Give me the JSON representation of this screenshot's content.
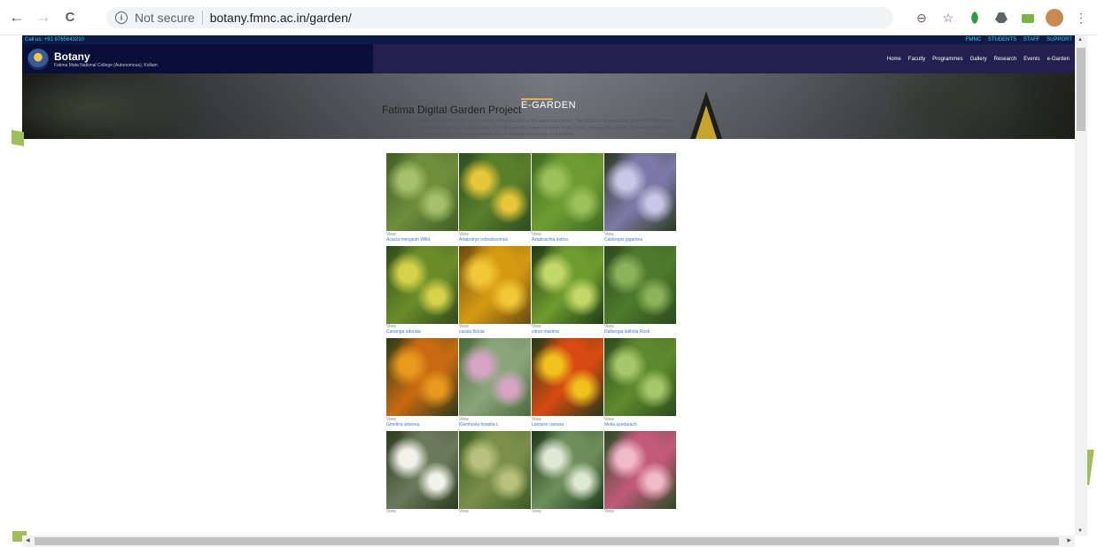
{
  "browser": {
    "back": "←",
    "forward": "→",
    "reload": "C",
    "security_label": "Not secure",
    "url": "botany.fmnc.ac.in/garden/",
    "zoom_icon": "⊖",
    "star_icon": "☆",
    "menu_icon": "⋮"
  },
  "site": {
    "call_us": "Call us: +91 9765643210",
    "top_links": [
      "FMNC",
      "STUDENTS",
      "STAFF",
      "SUPPORT"
    ],
    "brand_title": "Botany",
    "brand_subtitle": "Fatima Mata National College (Autonomous), Kollam",
    "menu": [
      "Home",
      "Faculty",
      "Programmes",
      "Gallery",
      "Research",
      "Events",
      "e-Garden"
    ],
    "hero_title": "E-GARDEN",
    "page_title": "Fatima Digital Garden Project",
    "intro": "The plants in the Campus are provided QR Codes, which will be labelled on the plants concerned. The database is maintained at the FATIMA Digital Garden Project page. The database is self-explanatory, which includes the botanical details of the plants, photographs, points of interest both for a student of Botany and a layman. The page incorporates URLs to detailed information on the plant."
  },
  "plants": [
    {
      "view": "View",
      "name": "Acacia mengium Willd",
      "colors": [
        "#3f5e24",
        "#6f8d3b",
        "#a6c16a"
      ]
    },
    {
      "view": "View",
      "name": "Artabotrys odoratissimus",
      "colors": [
        "#2c4d1f",
        "#5a7f2a",
        "#e7c63a"
      ]
    },
    {
      "view": "View",
      "name": "Azadirachta indica",
      "colors": [
        "#3d6a1e",
        "#6e9c33",
        "#9cc15a"
      ]
    },
    {
      "view": "View",
      "name": "Calotropis gigantea",
      "colors": [
        "#2b3a1f",
        "#7a7aa8",
        "#c8c8e6"
      ]
    },
    {
      "view": "View",
      "name": "Cananga odorata",
      "colors": [
        "#2f4a1a",
        "#6a8d2a",
        "#d6d24a"
      ]
    },
    {
      "view": "View",
      "name": "cassia fistula",
      "colors": [
        "#6a4a10",
        "#d59a12",
        "#f2c73a"
      ]
    },
    {
      "view": "View",
      "name": "citrus maxima",
      "colors": [
        "#1e3a14",
        "#6e9c2f",
        "#c4d86a"
      ]
    },
    {
      "view": "View",
      "name": "Dalbergia latifolia Roxb",
      "colors": [
        "#2a4a1c",
        "#4e7a2c",
        "#8cb35a"
      ]
    },
    {
      "view": "View",
      "name": "Gmelina arborea",
      "colors": [
        "#2a3a18",
        "#c86a12",
        "#e89a1c"
      ]
    },
    {
      "view": "View",
      "name": "Kleinhovia hospita L",
      "colors": [
        "#4a6a3a",
        "#8aa57a",
        "#d7a4c4"
      ]
    },
    {
      "view": "View",
      "name": "Lantana camara",
      "colors": [
        "#223a18",
        "#d84a12",
        "#f0c21c"
      ]
    },
    {
      "view": "View",
      "name": "Melia azedarach",
      "colors": [
        "#2d4a1a",
        "#5e8a2e",
        "#a7c86a"
      ]
    },
    {
      "view": "View",
      "name": "",
      "colors": [
        "#2a3b1e",
        "#6a7a5a",
        "#f2f2ea"
      ]
    },
    {
      "view": "View",
      "name": "",
      "colors": [
        "#3a5a22",
        "#7a8f4a",
        "#b9c27a"
      ]
    },
    {
      "view": "View",
      "name": "",
      "colors": [
        "#1d3a1a",
        "#6d8f5a",
        "#dfe8d4"
      ]
    },
    {
      "view": "View",
      "name": "",
      "colors": [
        "#2a4a22",
        "#c25a7a",
        "#f2b9c9"
      ]
    }
  ]
}
